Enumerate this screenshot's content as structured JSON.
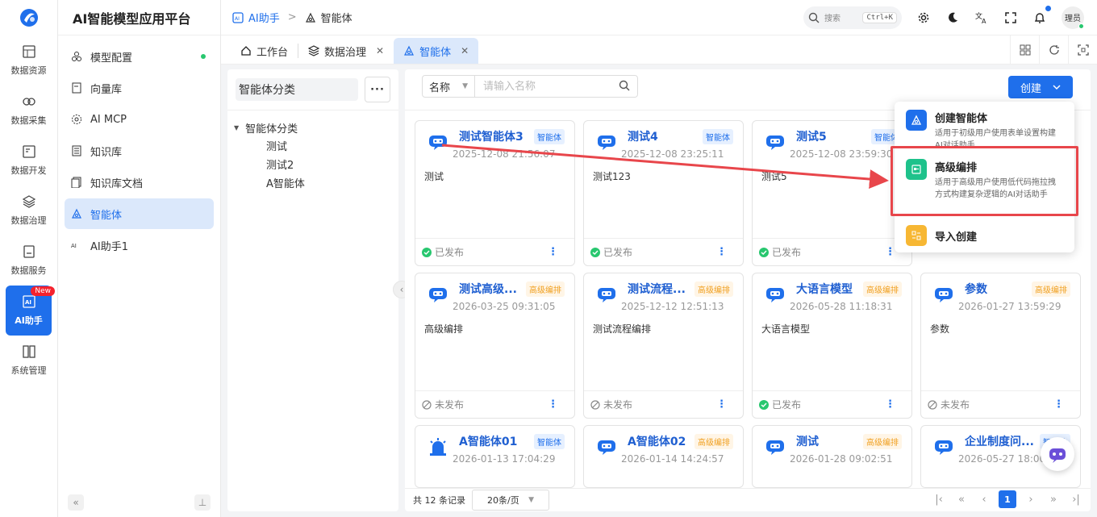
{
  "rail": {
    "items": [
      {
        "label": "数据资源",
        "icon": "database-grid-icon"
      },
      {
        "label": "数据采集",
        "icon": "collect-icon"
      },
      {
        "label": "数据开发",
        "icon": "develop-icon"
      },
      {
        "label": "数据治理",
        "icon": "layers-icon"
      },
      {
        "label": "数据服务",
        "icon": "service-icon"
      },
      {
        "label": "AI助手",
        "icon": "ai-icon",
        "badge": "New"
      },
      {
        "label": "系统管理",
        "icon": "system-icon"
      }
    ]
  },
  "sidebar": {
    "brand": "AI智能模型应用平台",
    "items": [
      {
        "label": "模型配置"
      },
      {
        "label": "向量库"
      },
      {
        "label": "AI MCP"
      },
      {
        "label": "知识库"
      },
      {
        "label": "知识库文档"
      },
      {
        "label": "智能体"
      },
      {
        "label": "AI助手1"
      }
    ]
  },
  "topbar": {
    "crumb_parent": "AI助手",
    "crumb_sep": ">",
    "crumb_current": "智能体",
    "search_label": "搜索",
    "search_kbd": "Ctrl+K",
    "avatar_text": "理员"
  },
  "tabs": [
    {
      "label": "工作台"
    },
    {
      "label": "数据治理"
    },
    {
      "label": "智能体"
    }
  ],
  "category_panel": {
    "title": "智能体分类",
    "more": "···",
    "root": "智能体分类",
    "children": [
      "测试",
      "测试2",
      "A智能体"
    ]
  },
  "filter": {
    "field": "名称",
    "placeholder": "请输入名称"
  },
  "create_button": "创建",
  "cards": [
    {
      "name": "测试智能体3",
      "tag": "智能体",
      "tag_type": "agent",
      "time": "2025-12-08 21:56:07",
      "desc": "测试",
      "status": "已发布",
      "published": true
    },
    {
      "name": "测试4",
      "tag": "智能体",
      "tag_type": "agent",
      "time": "2025-12-08 23:25:11",
      "desc": "测试123",
      "status": "已发布",
      "published": true
    },
    {
      "name": "测试5",
      "tag": "智能体",
      "tag_type": "agent",
      "time": "2025-12-08 23:59:30",
      "desc": "测试5",
      "status": "已发布",
      "published": true
    },
    {
      "name": "",
      "tag": "",
      "tag_type": "agent",
      "time": "",
      "desc": "",
      "status": "",
      "published": true
    },
    {
      "name": "测试高级...",
      "tag": "高级编排",
      "tag_type": "advanced",
      "time": "2026-03-25 09:31:05",
      "desc": "高级编排",
      "status": "未发布",
      "published": false
    },
    {
      "name": "测试流程...",
      "tag": "高级编排",
      "tag_type": "advanced",
      "time": "2025-12-12 12:51:13",
      "desc": "测试流程编排",
      "status": "未发布",
      "published": false
    },
    {
      "name": "大语言模型",
      "tag": "高级编排",
      "tag_type": "advanced",
      "time": "2026-05-28 11:18:31",
      "desc": "大语言模型",
      "status": "已发布",
      "published": true
    },
    {
      "name": "参数",
      "tag": "高级编排",
      "tag_type": "advanced",
      "time": "2026-01-27 13:59:29",
      "desc": "参数",
      "status": "未发布",
      "published": false
    },
    {
      "name": "A智能体01",
      "tag": "智能体",
      "tag_type": "agent",
      "time": "2026-01-13 17:04:29",
      "desc": "",
      "status": "",
      "published": true,
      "alarm": true
    },
    {
      "name": "A智能体02",
      "tag": "高级编排",
      "tag_type": "advanced",
      "time": "2026-01-14 14:24:57",
      "desc": "",
      "status": "",
      "published": true
    },
    {
      "name": "测试",
      "tag": "高级编排",
      "tag_type": "advanced",
      "time": "2026-01-28 09:02:51",
      "desc": "",
      "status": "",
      "published": true
    },
    {
      "name": "企业制度问...",
      "tag": "智能体",
      "tag_type": "agent",
      "time": "2026-05-27 18:00:3",
      "desc": "",
      "status": "",
      "published": true
    }
  ],
  "dropdown": [
    {
      "title": "创建智能体",
      "desc": "适用于初级用户使用表单设置构建AI对话助手",
      "icon": "agent-create-icon",
      "color": "#1f6feb"
    },
    {
      "title": "高级编排",
      "desc": "适用于高级用户使用低代码拖拉拽方式构建复杂逻辑的AI对话助手",
      "icon": "workflow-icon",
      "color": "#1ec28b"
    },
    {
      "title": "导入创建",
      "desc": "",
      "icon": "import-icon",
      "color": "#f7b733"
    }
  ],
  "pagination": {
    "total_prefix": "共",
    "total": "12",
    "total_suffix": "条记录",
    "page_size": "20条/页",
    "current": "1"
  },
  "colors": {
    "primary": "#1f6feb",
    "published": "#28c76f",
    "agent_tag_bg": "#e6f0ff",
    "advanced_tag_bg": "#fff5e6",
    "highlight": "#e8464b"
  }
}
